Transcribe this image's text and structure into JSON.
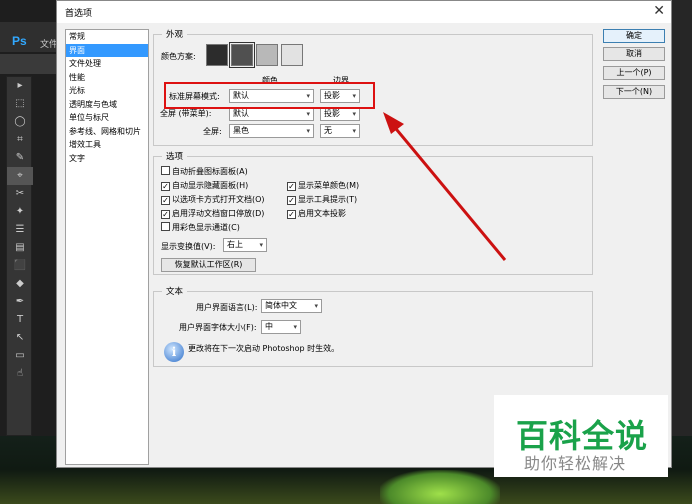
{
  "ps": {
    "logo": "Ps",
    "menu_label": "文件",
    "tools": [
      "▸",
      "⬚",
      "◯",
      "⌗",
      "✎",
      "⌖",
      "✂",
      "✦",
      "☰",
      "▤",
      "⬛",
      "◆",
      "✒",
      "T",
      "↖",
      "▭",
      "☝"
    ]
  },
  "dialog": {
    "title": "首选项",
    "close": "✕"
  },
  "nav": {
    "items": [
      "常规",
      "界面",
      "文件处理",
      "性能",
      "光标",
      "透明度与色域",
      "单位与标尺",
      "参考线、网格和切片",
      "增效工具",
      "文字"
    ],
    "selected_index": 1
  },
  "appearance": {
    "group_label": "外观",
    "color_scheme_label": "颜色方案:",
    "swatch_colors": [
      "#2c2c2c",
      "#505050",
      "#b8b8b8",
      "#e2e2e2"
    ],
    "col_color": "颜色",
    "col_border": "边界",
    "rows": [
      {
        "label": "标准屏幕模式:",
        "color": "默认",
        "border": "投影"
      },
      {
        "label": "全屏 (带菜单):",
        "color": "默认",
        "border": "投影"
      },
      {
        "label": "全屏:",
        "color": "黑色",
        "border": "无"
      }
    ]
  },
  "options": {
    "group_label": "选项",
    "checks": [
      {
        "label": "自动折叠图标面板(A)",
        "checked": false
      },
      {
        "label": "自动显示隐藏面板(H)",
        "checked": true
      },
      {
        "label": "显示菜单颜色(M)",
        "checked": true
      },
      {
        "label": "以选项卡方式打开文档(O)",
        "checked": true
      },
      {
        "label": "显示工具提示(T)",
        "checked": true
      },
      {
        "label": "启用浮动文档窗口停放(D)",
        "checked": true
      },
      {
        "label": "启用文本投影",
        "checked": true
      },
      {
        "label": "用彩色显示通道(C)",
        "checked": false
      }
    ],
    "show_transform_label": "显示变换值(V):",
    "show_transform_value": "右上",
    "reset_button": "恢复默认工作区(R)"
  },
  "text": {
    "group_label": "文本",
    "ui_language_label": "用户界面语言(L):",
    "ui_language_value": "简体中文",
    "ui_font_size_label": "用户界面字体大小(F):",
    "ui_font_size_value": "中",
    "info_message": "更改将在下一次启动 Photoshop 时生效。",
    "info_icon": "i"
  },
  "buttons": {
    "ok": "确定",
    "cancel": "取消",
    "prev": "上一个(P)",
    "next": "下一个(N)"
  },
  "watermark": {
    "title": "百科全说",
    "subtitle": "助你轻松解决"
  },
  "colors": {
    "highlight": "#dd1111",
    "nav_selected": "#3399ff",
    "watermark_green": "#1aa24a"
  }
}
